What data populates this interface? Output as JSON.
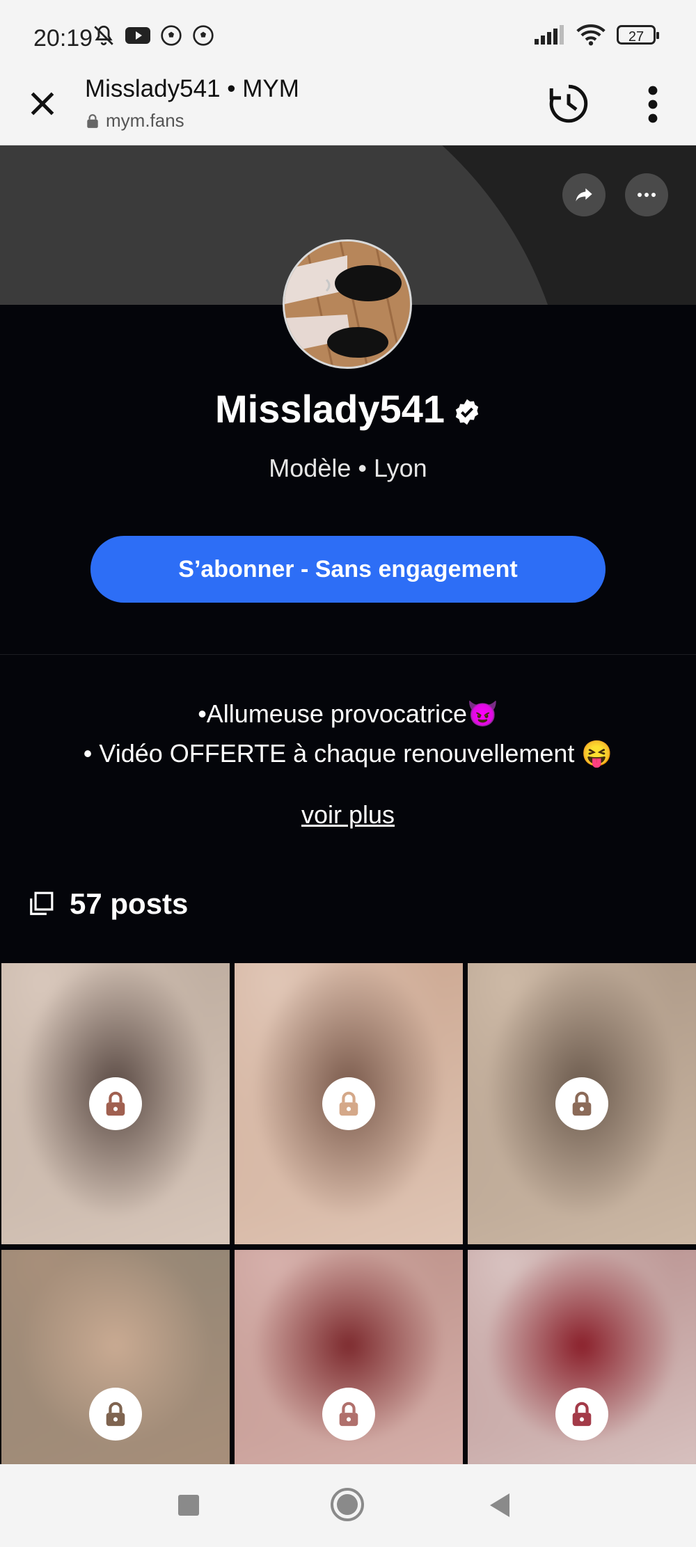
{
  "status_bar": {
    "time": "20:19",
    "left_icons": [
      "bell-off-icon",
      "youtube-icon",
      "soccer-ball-icon",
      "soccer-ball-icon"
    ],
    "right_icons": [
      "signal-icon",
      "wifi-icon",
      "battery-icon"
    ],
    "battery": "27"
  },
  "browser": {
    "title": "Misslady541 • MYM",
    "url": "mym.fans"
  },
  "profile": {
    "name": "Misslady541",
    "subtitle": "Modèle • Lyon",
    "subscribe_label": "S’abonner - Sans engagement",
    "bio_line1": "•Allumeuse provocatrice😈",
    "bio_line2": "• Vidéo OFFERTE à chaque renouvellement 😝",
    "see_more": "voir plus",
    "posts_count": "57 posts"
  },
  "colors": {
    "accent": "#2d6ef6",
    "background": "#04050a",
    "banner": "#212121"
  },
  "grid_tiles": [
    {
      "locked": true,
      "colors": [
        "#b9a89a",
        "#5a4a44",
        "#d8c7bb"
      ]
    },
    {
      "locked": true,
      "colors": [
        "#c9a38c",
        "#7a5a4c",
        "#e0c6b6"
      ]
    },
    {
      "locked": true,
      "colors": [
        "#a89482",
        "#6b5a4d",
        "#cdb9a6"
      ]
    },
    {
      "locked": true,
      "colors": [
        "#8f8474",
        "#c9aa92",
        "#a88f7a"
      ]
    },
    {
      "locked": true,
      "colors": [
        "#b98d84",
        "#7d2a2e",
        "#d6b0ab"
      ]
    },
    {
      "locked": true,
      "colors": [
        "#b48a88",
        "#8a1f2a",
        "#d8c2c0"
      ]
    }
  ]
}
